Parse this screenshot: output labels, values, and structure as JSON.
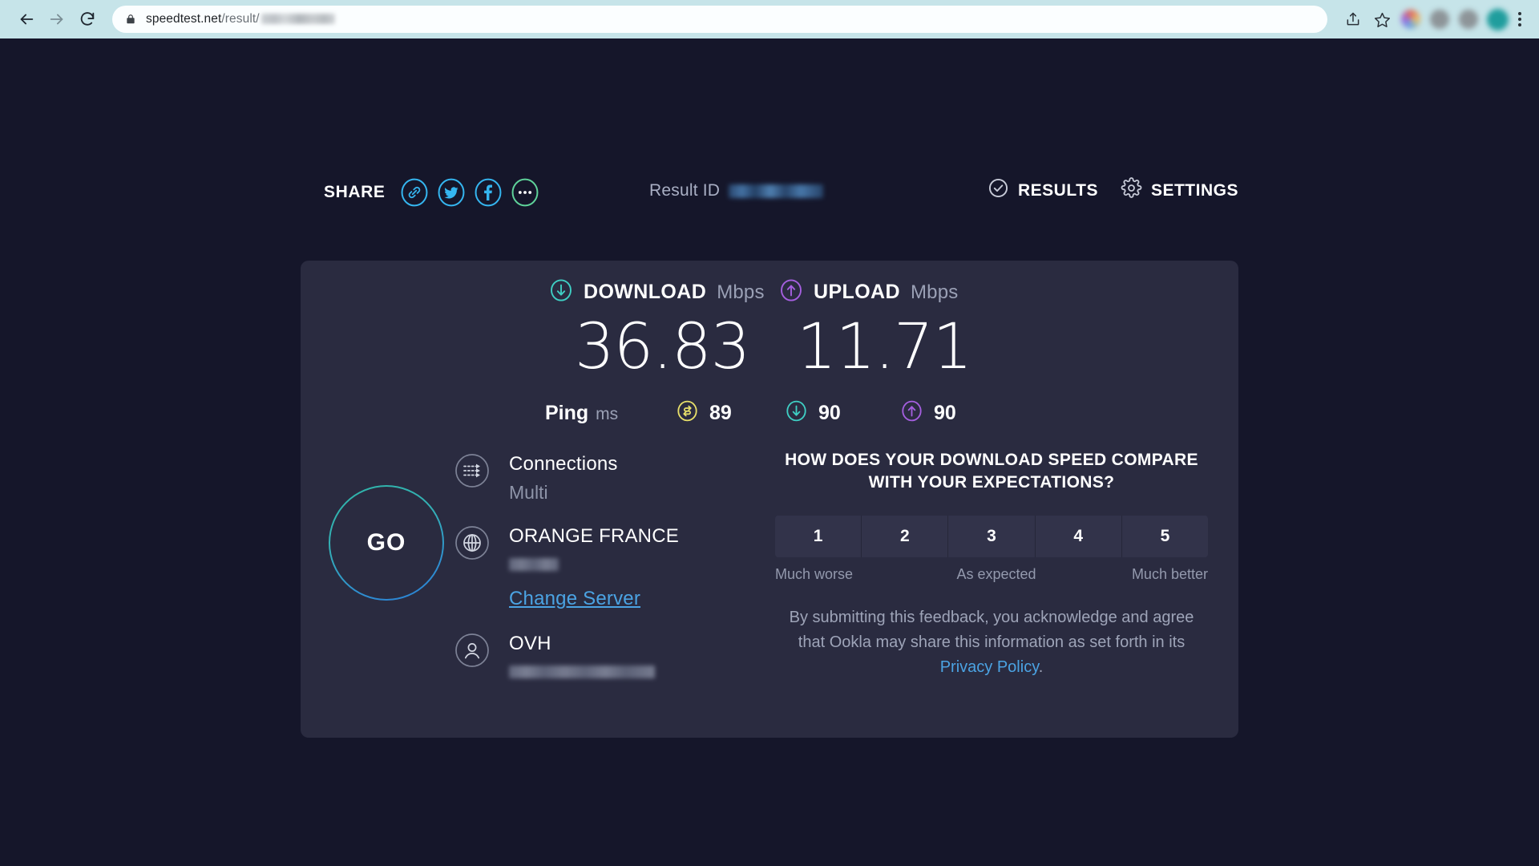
{
  "browser": {
    "back_icon": "back-arrow-icon",
    "forward_icon": "forward-arrow-icon",
    "reload_icon": "reload-icon",
    "lock_icon": "lock-icon",
    "url_visible": "speedtest.net/result/",
    "url_domain": "speedtest.net",
    "url_path": "/result/",
    "url_id_redacted": true,
    "menu_icon": "kebab-menu-icon",
    "profile_avatar_color": "#1f9d9d"
  },
  "toolbar": {
    "share_label": "SHARE",
    "share_icons": [
      "link-icon",
      "twitter-icon",
      "facebook-icon",
      "more-options-icon"
    ],
    "result_id_label": "Result ID",
    "result_id_value_redacted": true,
    "results_label": "RESULTS",
    "results_icon": "check-circle-icon",
    "settings_label": "SETTINGS",
    "settings_icon": "gear-icon"
  },
  "results": {
    "download": {
      "label": "DOWNLOAD",
      "unit": "Mbps",
      "value": "36.83",
      "icon": "download-arrow-icon",
      "color": "#3fcfc4"
    },
    "upload": {
      "label": "UPLOAD",
      "unit": "Mbps",
      "value": "11.71",
      "icon": "upload-arrow-icon",
      "color": "#a55fe0"
    },
    "ping": {
      "label": "Ping",
      "unit": "ms",
      "idle": {
        "value": "89",
        "icon": "idle-latency-icon",
        "color": "#e8e06a"
      },
      "download": {
        "value": "90",
        "icon": "download-arrow-icon",
        "color": "#3fcfc4"
      },
      "upload": {
        "value": "90",
        "icon": "upload-arrow-icon",
        "color": "#a55fe0"
      }
    }
  },
  "go_button": {
    "label": "GO"
  },
  "connection_info": [
    {
      "icon": "connections-icon",
      "title": "Connections",
      "subtitle": "Multi",
      "redacted": false
    },
    {
      "icon": "globe-icon",
      "title": "ORANGE FRANCE",
      "subtitle": "Paris",
      "redacted": true
    },
    {
      "icon": "person-icon",
      "title": "OVH",
      "subtitle": "",
      "redacted": true
    }
  ],
  "change_server_label": "Change Server",
  "feedback": {
    "question_line1": "HOW DOES YOUR DOWNLOAD SPEED COMPARE",
    "question_line2": "WITH YOUR EXPECTATIONS?",
    "ratings": [
      "1",
      "2",
      "3",
      "4",
      "5"
    ],
    "scale_low": "Much worse",
    "scale_mid": "As expected",
    "scale_high": "Much better",
    "note_text": "By submitting this feedback, you acknowledge and agree that Ookla may share this information as set forth in its ",
    "privacy_link": "Privacy Policy",
    "note_end": "."
  },
  "colors": {
    "page_background": "#15162a",
    "card_background": "#2a2b40",
    "browser_chrome": "#c6e4e9",
    "accent_download": "#3fcfc4",
    "accent_upload": "#a55fe0",
    "accent_link": "#4ba3e3",
    "accent_share": "#35b6f0",
    "accent_more": "#5fd39a"
  }
}
